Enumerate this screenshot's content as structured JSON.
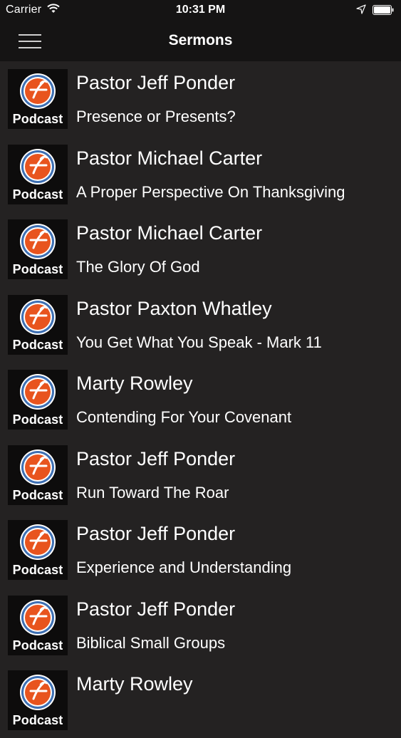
{
  "status_bar": {
    "carrier": "Carrier",
    "time": "10:31 PM"
  },
  "nav": {
    "title": "Sermons"
  },
  "thumbnail": {
    "label": "Podcast",
    "icon": "podcast-logo-icon",
    "accent_color": "#e8541e",
    "ring_color": "#3d6fb3"
  },
  "sermons": [
    {
      "speaker": "Pastor Jeff Ponder",
      "title": "Presence or Presents?"
    },
    {
      "speaker": "Pastor Michael Carter",
      "title": "A Proper Perspective On Thanksgiving"
    },
    {
      "speaker": "Pastor Michael Carter",
      "title": "The Glory Of God"
    },
    {
      "speaker": "Pastor Paxton Whatley",
      "title": "You Get What You Speak - Mark 11"
    },
    {
      "speaker": "Marty Rowley",
      "title": "Contending For Your Covenant"
    },
    {
      "speaker": "Pastor Jeff Ponder",
      "title": "Run Toward The Roar"
    },
    {
      "speaker": "Pastor Jeff Ponder",
      "title": "Experience and Understanding"
    },
    {
      "speaker": "Pastor Jeff Ponder",
      "title": "Biblical Small Groups"
    },
    {
      "speaker": "Marty Rowley",
      "title": ""
    }
  ]
}
